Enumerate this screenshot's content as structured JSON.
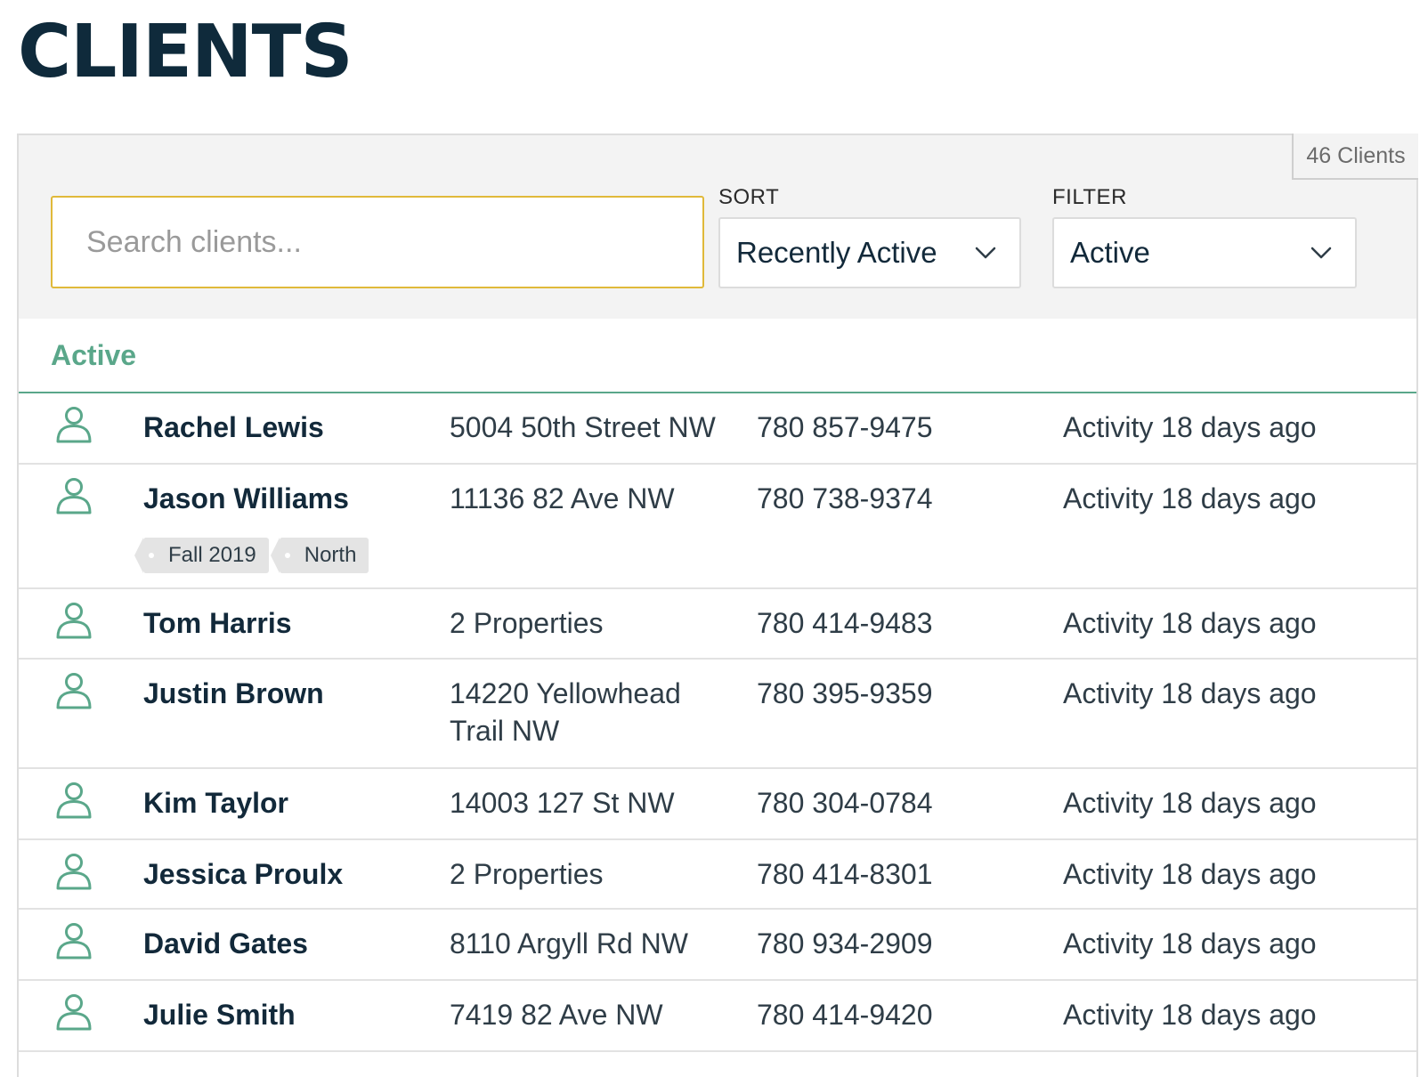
{
  "page": {
    "title": "CLIENTS"
  },
  "toolbar": {
    "client_count": "46 Clients",
    "search": {
      "placeholder": "Search clients...",
      "value": ""
    },
    "sort": {
      "label": "SORT",
      "selected": "Recently Active"
    },
    "filter": {
      "label": "FILTER",
      "selected": "Active"
    }
  },
  "section": {
    "title": "Active"
  },
  "icons": {
    "client": "person-icon",
    "dropdown": "chevron-down-icon"
  },
  "colors": {
    "accent": "#5aa78a",
    "search_border": "#e0b93a",
    "title": "#0f2a3b"
  },
  "clients": [
    {
      "name": "Rachel Lewis",
      "address": "5004 50th Street NW",
      "phone": "780 857-9475",
      "activity": "Activity 18 days ago",
      "tags": []
    },
    {
      "name": "Jason Williams",
      "address": "11136 82 Ave NW",
      "phone": "780 738-9374",
      "activity": "Activity 18 days ago",
      "tags": [
        "Fall 2019",
        "North"
      ]
    },
    {
      "name": "Tom Harris",
      "address": "2 Properties",
      "phone": "780 414-9483",
      "activity": "Activity 18 days ago",
      "tags": []
    },
    {
      "name": "Justin Brown",
      "address": "14220 Yellowhead Trail NW",
      "phone": "780 395-9359",
      "activity": "Activity 18 days ago",
      "tags": []
    },
    {
      "name": "Kim Taylor",
      "address": "14003 127 St NW",
      "phone": "780 304-0784",
      "activity": "Activity 18 days ago",
      "tags": []
    },
    {
      "name": "Jessica Proulx",
      "address": "2 Properties",
      "phone": "780 414-8301",
      "activity": "Activity 18 days ago",
      "tags": []
    },
    {
      "name": "David Gates",
      "address": "8110 Argyll Rd NW",
      "phone": "780 934-2909",
      "activity": "Activity 18 days ago",
      "tags": []
    },
    {
      "name": "Julie Smith",
      "address": "7419 82 Ave NW",
      "phone": "780 414-9420",
      "activity": "Activity 18 days ago",
      "tags": []
    }
  ]
}
